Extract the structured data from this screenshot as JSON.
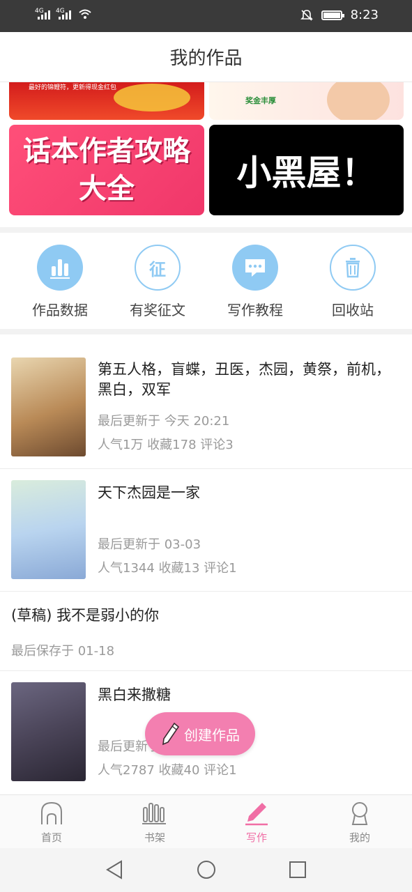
{
  "status_bar": {
    "signal_1": "4G",
    "signal_2": "4G",
    "time": "8:23",
    "icons": [
      "wifi-icon",
      "mute-icon",
      "battery-icon"
    ]
  },
  "header": {
    "title": "我的作品"
  },
  "banners": {
    "top_left_crop": {
      "text": "最好的锦鲤符，更新得现金红包"
    },
    "top_right_crop": {
      "text": "奖金丰厚"
    },
    "guide": {
      "line1": "话本作者攻略",
      "line2": "大全"
    },
    "dark_room": {
      "text": "小黑屋！"
    }
  },
  "quick_actions": [
    {
      "label": "作品数据",
      "icon": "bar-chart-icon"
    },
    {
      "label": "有奖征文",
      "icon": "zheng-badge-icon",
      "glyph": "征"
    },
    {
      "label": "写作教程",
      "icon": "chat-bubble-icon"
    },
    {
      "label": "回收站",
      "icon": "trash-icon"
    }
  ],
  "works": [
    {
      "title": "第五人格，盲蝶，丑医，杰园，黄祭，前机，黑白，双军",
      "updated": "最后更新于 今天 20:21",
      "stats": "人气1万 收藏178 评论3"
    },
    {
      "title": "天下杰园是一家",
      "updated": "最后更新于 03-03",
      "stats": "人气1344 收藏13 评论1"
    },
    {
      "title": "(草稿) 我不是弱小的你",
      "updated": "最后保存于 01-18"
    },
    {
      "title": "黑白来撒糖",
      "updated": "最后更新于",
      "stats": "人气2787 收藏40 评论1"
    }
  ],
  "fab": {
    "label": "创建作品",
    "icon": "pencil-icon"
  },
  "tab_bar": {
    "active": "写作",
    "items": [
      {
        "label": "首页",
        "icon": "home-icon"
      },
      {
        "label": "书架",
        "icon": "bookshelf-icon"
      },
      {
        "label": "写作",
        "icon": "pen-icon"
      },
      {
        "label": "我的",
        "icon": "profile-icon"
      }
    ]
  },
  "colors": {
    "accent": "#f06ea5",
    "fab": "#f37fb0",
    "icon_blue": "#8fcaf3",
    "guide_banner": "#f0376a",
    "text_meta": "#9a9a9a"
  }
}
